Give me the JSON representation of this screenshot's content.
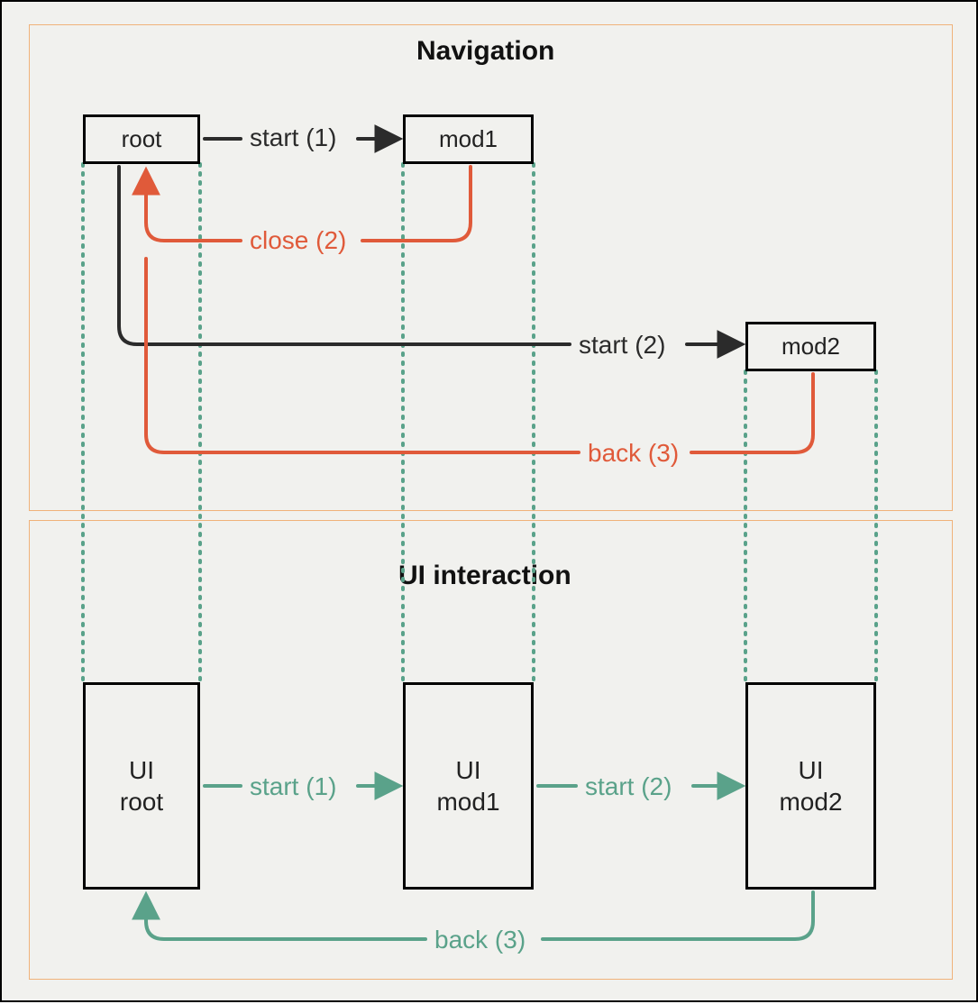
{
  "panels": {
    "navigation": {
      "title": "Navigation"
    },
    "ui": {
      "title": "UI interaction"
    }
  },
  "nodes": {
    "root": {
      "label": "root"
    },
    "mod1": {
      "label": "mod1"
    },
    "mod2": {
      "label": "mod2"
    },
    "ui_root": {
      "label": "UI\nroot"
    },
    "ui_mod1": {
      "label": "UI\nmod1"
    },
    "ui_mod2": {
      "label": "UI\nmod2"
    }
  },
  "edges": {
    "nav_start1": {
      "label": "start (1)"
    },
    "nav_close2": {
      "label": "close (2)"
    },
    "nav_start2": {
      "label": "start (2)"
    },
    "nav_back3": {
      "label": "back (3)"
    },
    "ui_start1": {
      "label": "start (1)"
    },
    "ui_start2": {
      "label": "start (2)"
    },
    "ui_back3": {
      "label": "back (3)"
    }
  },
  "colors": {
    "black": "#2b2b2b",
    "red": "#e05a3a",
    "green": "#5aa28a",
    "panel_border": "#f0b27a",
    "bg": "#f1f1ee"
  }
}
